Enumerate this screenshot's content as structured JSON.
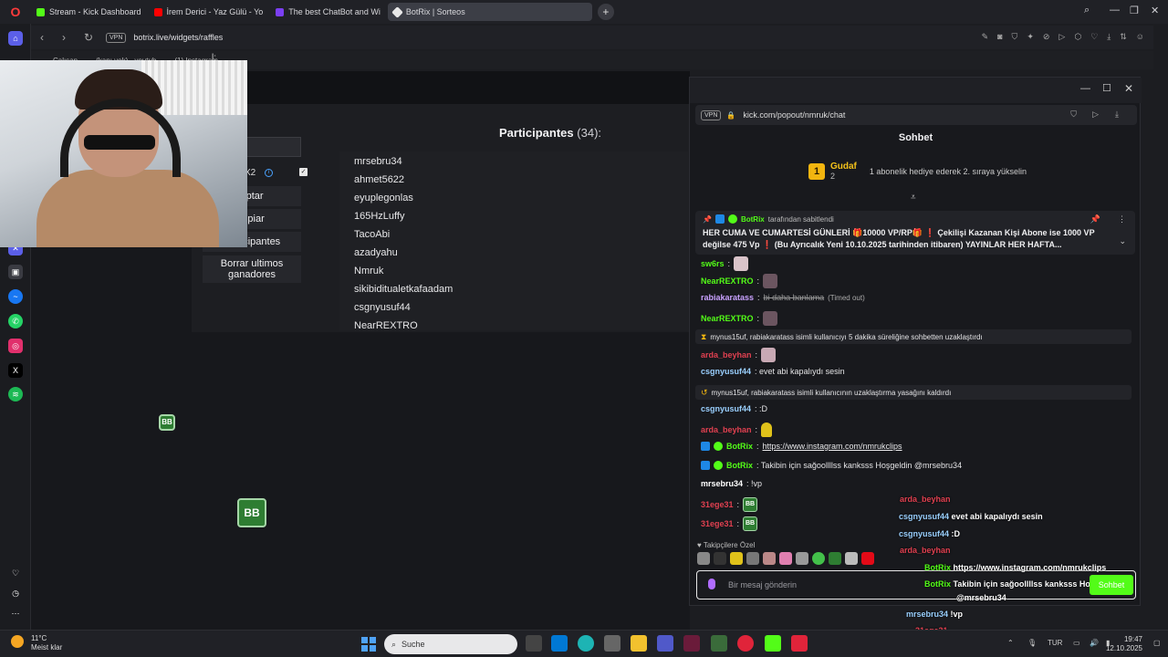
{
  "browser": {
    "tabs": [
      {
        "label": "Stream - Kick Dashboard",
        "color": "#53fc18"
      },
      {
        "label": "İrem Derici - Yaz Gülü - Yo",
        "color": "#ff0000"
      },
      {
        "label": "The best ChatBot and Wi",
        "color": "#7b3ff2"
      },
      {
        "label": "BotRix | Sorteos",
        "color": "#e8e8e8"
      }
    ],
    "vpn_label": "VPN",
    "url": "botrix.live/widgets/raffles",
    "bookmarks": [
      "Çalışan",
      "(kanı yok) - youtub",
      "(1) Instagram"
    ]
  },
  "raffle": {
    "form_label": "l:",
    "check_label": "X2",
    "buttons": {
      "accept": "eptar",
      "clear": "mpiar",
      "participants": "participantes",
      "clear_winners": "Borrar ultimos ganadores"
    },
    "participants_title": "Participantes",
    "participants_count": "(34):",
    "participants": [
      "mrsebru34",
      "ahmet5622",
      "eyuplegonlas",
      "165HzLuffy",
      "TacoAbi",
      "azadyahu",
      "Nmruk",
      "sikibiditualetkafaadam",
      "csgnyusuf44",
      "NearREXTRO"
    ],
    "emote_label": "BB"
  },
  "chat_window": {
    "vpn_label": "VPN",
    "url": "kick.com/popout/nmruk/chat",
    "title": "Sohbet",
    "leader": {
      "rank": "1",
      "name": "Gudaf",
      "count": "2",
      "text": "1 abonelik hediye ederek 2. sıraya yükselin"
    },
    "pinned": {
      "by_user": "BotRix",
      "by_text": "tarafından sabitlendi",
      "text": "HER CUMA VE CUMARTESİ GÜNLERİ 🎁10000 VP/RP🎁 ❗ Çekilişi Kazanan Kişi Abone ise 1000 VP değilse 475 Vp ❗ (Bu Ayrıcalık Yeni 10.10.2025 tarihinden itibaren) YAYINLAR HER HAFTA..."
    },
    "messages": [
      {
        "user": "sw6rs",
        "text": ":",
        "color": "#53fc18"
      },
      {
        "user": "NearREXTRO",
        "text": ":",
        "color": "#53fc18"
      },
      {
        "user": "rabiakaratass",
        "text": ":",
        "deleted": "bi daha banlama",
        "note": "(Timed out)",
        "color": "#c9a2ff"
      },
      {
        "user": "NearREXTRO",
        "text": ":",
        "color": "#53fc18"
      },
      {
        "sys": "mynus15uf, rabiakaratass isimli kullanıcıyı 5 dakika süreliğine sohbetten uzaklaştırdı"
      },
      {
        "user": "arda_beyhan",
        "text": ":",
        "color": "#e04050"
      },
      {
        "user": "csgnyusuf44",
        "text": ": evet abi kapalıydı sesin",
        "color": "#9ad0ff"
      },
      {
        "sys": "mynus15uf, rabiakaratass isimli kullanıcının uzaklaştırma yasağını kaldırdı"
      },
      {
        "user": "csgnyusuf44",
        "text": ": :D",
        "color": "#9ad0ff"
      },
      {
        "user": "arda_beyhan",
        "text": ":",
        "color": "#e04050"
      },
      {
        "user": "BotRix",
        "text": ":",
        "link": "https://www.instagram.com/nmrukclips",
        "color": "#53fc18"
      },
      {
        "user": "BotRix",
        "text": ": Takibin için sağoollllss kanksss Hoşgeldin @mrsebru34",
        "color": "#53fc18"
      },
      {
        "user": "mrsebru34",
        "text": ": !vp",
        "color": "#ffffff"
      },
      {
        "user": "31ege31",
        "text": ":",
        "color": "#e04050"
      },
      {
        "user": "31ege31",
        "text": ":",
        "color": "#e04050"
      }
    ],
    "followers_label": "Takipçilere Özel",
    "input_placeholder": "Bir mesaj gönderin",
    "send_label": "Sohbet",
    "emote_label": "BB"
  },
  "overlay_chat": [
    {
      "user": "arda_beyhan",
      "text": ""
    },
    {
      "user": "csgnyusuf44",
      "text": "evet abi kapalıydı sesin"
    },
    {
      "user": "csgnyusuf44",
      "text": ":D"
    },
    {
      "user": "arda_beyhan",
      "text": ""
    },
    {
      "user": "BotRix",
      "text": "https://www.instagram.com/nmrukclips"
    },
    {
      "user": "BotRix",
      "text": "Takibin için sağoollllss kanksss Hoşgeldin"
    },
    {
      "user": "",
      "text": "@mrsebru34"
    },
    {
      "user": "mrsebru34",
      "text": "!vp"
    },
    {
      "user": "31ege31",
      "text": ""
    },
    {
      "user": "31ege31",
      "text": ""
    }
  ],
  "taskbar": {
    "temp": "11°C",
    "weather": "Meist klar",
    "search": "Suche",
    "lang": "TUR",
    "time": "19:47",
    "date": "12.10.2025"
  },
  "colors": {
    "kick_green": "#53fc18",
    "accent_red": "#e04050",
    "gold": "#f2b50f"
  }
}
